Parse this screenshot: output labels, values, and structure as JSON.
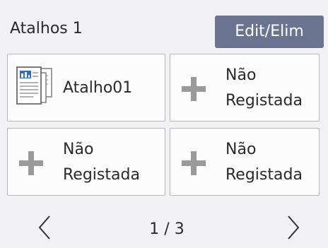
{
  "header": {
    "title": "Atalhos 1",
    "edit_label": "Edit/Elim"
  },
  "tiles": [
    {
      "line1": "Atalho01",
      "line2": "",
      "icon": "document-shortcut-icon"
    },
    {
      "line1": "Não",
      "line2": "Registada",
      "icon": "plus-icon"
    },
    {
      "line1": "Não",
      "line2": "Registada",
      "icon": "plus-icon"
    },
    {
      "line1": "Não",
      "line2": "Registada",
      "icon": "plus-icon"
    }
  ],
  "pager": {
    "indicator": "1 / 3",
    "prev_icon": "chevron-left-icon",
    "next_icon": "chevron-right-icon"
  },
  "colors": {
    "background": "#f2f2f4",
    "edit_button": "#6a7490",
    "plus_icon": "#9a9a9a"
  }
}
